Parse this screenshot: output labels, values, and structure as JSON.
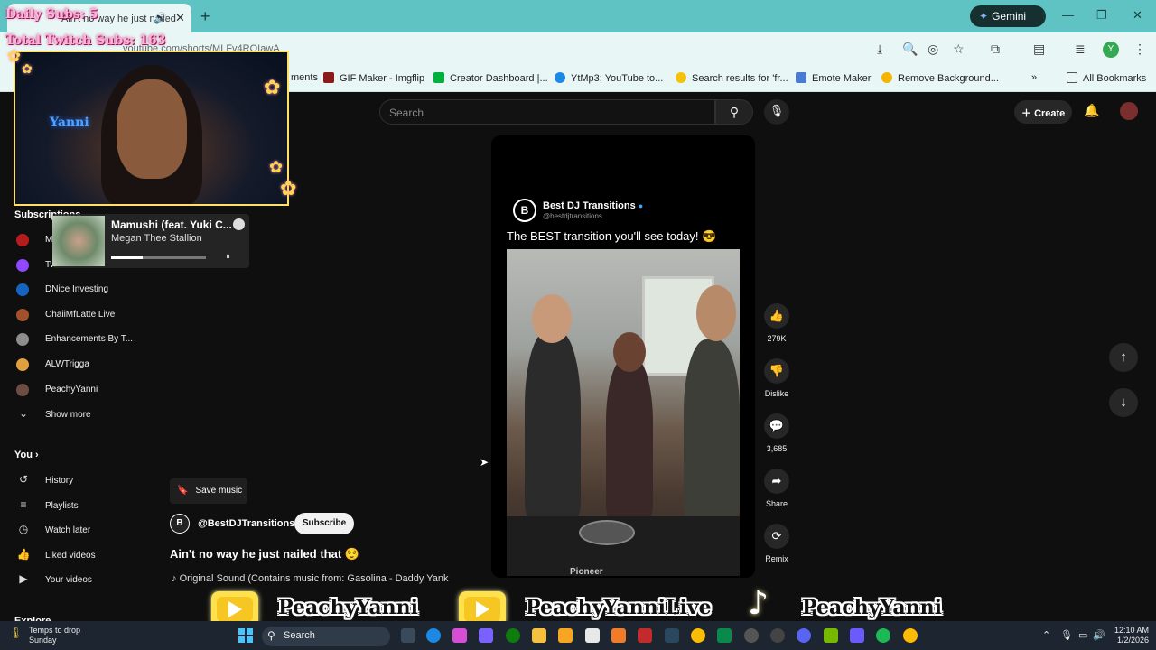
{
  "browser": {
    "tab_title": "Ain't no way he just nailed",
    "audio_icon": "speaker-icon",
    "url": "youtube.com/shorts/MLFv4RQIawA",
    "gemini_label": "Gemini",
    "profile_initial": "Y",
    "bookmarks": [
      {
        "label": "ments",
        "color": ""
      },
      {
        "label": "GIF Maker - Imgflip",
        "color": "#8b1a1a"
      },
      {
        "label": "Creator Dashboard |...",
        "color": "#00b140"
      },
      {
        "label": "YtMp3: YouTube to...",
        "color": "#1e88e5"
      },
      {
        "label": "Search results for 'fr...",
        "color": "#f4c20d"
      },
      {
        "label": "Emote Maker",
        "color": "#4a7bd0"
      },
      {
        "label": "Remove Background...",
        "color": "#f4b400"
      }
    ],
    "all_bookmarks": "All Bookmarks"
  },
  "youtube": {
    "search_placeholder": "Search",
    "create_label": "Create",
    "sidebar": {
      "subscriptions_heading": "Subscriptions",
      "subscriptions": [
        {
          "label": "M",
          "color": "#b71c1c"
        },
        {
          "label": "Tw",
          "color": "#9146ff"
        },
        {
          "label": "DNice Investing",
          "color": "#1565c0"
        },
        {
          "label": "ChaiiMfLatte Live",
          "color": "#a0522d"
        },
        {
          "label": "Enhancements By T...",
          "color": "#8d8d8d"
        },
        {
          "label": "ALWTrigga",
          "color": "#e0a040"
        },
        {
          "label": "PeachyYanni",
          "color": "#6d4c41"
        }
      ],
      "show_more": "Show more",
      "you_heading": "You",
      "you_items": [
        {
          "label": "History",
          "icon": "history-icon"
        },
        {
          "label": "Playlists",
          "icon": "playlists-icon"
        },
        {
          "label": "Watch later",
          "icon": "watch-later-icon"
        },
        {
          "label": "Liked videos",
          "icon": "like-icon"
        },
        {
          "label": "Your videos",
          "icon": "your-videos-icon"
        }
      ],
      "explore_heading": "Explore"
    },
    "short": {
      "channel_name": "Best DJ Transitions",
      "channel_handle": "@bestdjtransitions",
      "caption": "The BEST transition you'll see today! 😎",
      "brand_text": "Pioneer",
      "save_music": "Save music",
      "channel_row_name": "@BestDJTransitions",
      "subscribe": "Subscribe",
      "title": "Ain't no way he just nailed that 😌",
      "sound": "Original Sound (Contains music from: Gasolina - Daddy Yank"
    },
    "actions": {
      "likes": "279K",
      "dislike": "Dislike",
      "comments": "3,685",
      "share": "Share",
      "remix": "Remix"
    }
  },
  "overlay": {
    "daily_subs": "Daily Subs: 5",
    "total_subs": "Total Twitch Subs: 163",
    "neon_sign": "Yanni",
    "spotify": {
      "title": "Mamushi (feat. Yuki C...",
      "artist": "Megan Thee Stallion",
      "progress": 0.33
    },
    "promo": [
      "PeachyYanni",
      "PeachyYanniLive",
      "PeachyYanni"
    ]
  },
  "taskbar": {
    "weather_line1": "Temps to drop",
    "weather_line2": "Sunday",
    "search_label": "Search",
    "time": "12:10 AM",
    "date": "1/2/2026"
  }
}
